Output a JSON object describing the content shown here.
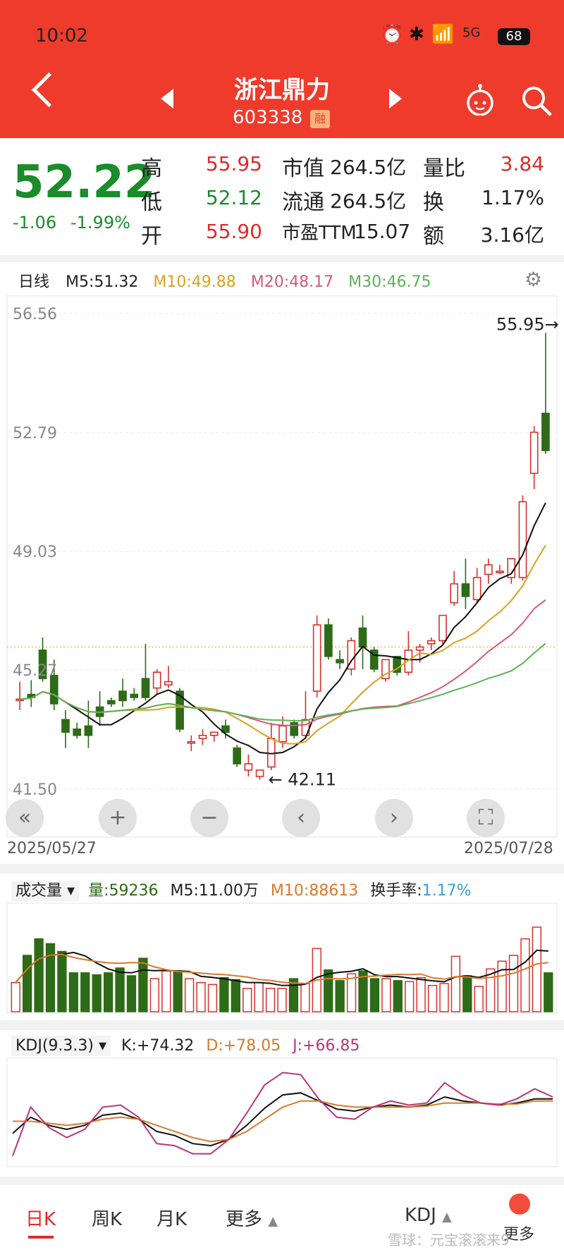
{
  "status": {
    "time": "10:02",
    "battery": "68",
    "signal": "5G"
  },
  "header": {
    "name": "浙江鼎力",
    "code": "603338",
    "badge": "融"
  },
  "quote": {
    "price": "52.22",
    "change": "-1.06",
    "change_pct": "-1.99%",
    "rows": [
      {
        "l1": "高",
        "v1": "55.95",
        "l2": "市值",
        "v2": "264.5亿",
        "l3": "量比",
        "v3": "3.84"
      },
      {
        "l1": "低",
        "v1": "52.12",
        "l2": "流通",
        "v2": "264.5亿",
        "l3": "换",
        "v3": "1.17%"
      },
      {
        "l1": "开",
        "v1": "55.90",
        "l2": "市盈TTM",
        "v2": "15.07",
        "l3": "额",
        "v3": "3.16亿"
      }
    ]
  },
  "kline": {
    "period": "日线",
    "ma": [
      {
        "label": "M5:51.32",
        "color": "#222222"
      },
      {
        "label": "M10:49.88",
        "color": "#d9a21b"
      },
      {
        "label": "M20:48.17",
        "color": "#d9577a"
      },
      {
        "label": "M30:46.75",
        "color": "#5db356"
      }
    ],
    "y_ticks": [
      "56.56",
      "52.79",
      "49.03",
      "45.27",
      "41.50"
    ],
    "high_label": "55.95",
    "low_label": "42.11",
    "date_start": "2025/05/27",
    "date_end": "2025/07/28"
  },
  "chart_data": [
    {
      "type": "candlestick",
      "x": [
        "2025/05/27",
        "2025/07/28"
      ],
      "ylim": [
        41.5,
        56.56
      ],
      "y_ticks": [
        56.56,
        52.79,
        49.03,
        45.27,
        41.5
      ],
      "candles": [
        [
          44.35,
          44.9,
          44.35,
          44.0
        ],
        [
          44.5,
          44.95,
          44.4,
          44.1
        ],
        [
          45.9,
          46.3,
          45.0,
          44.9
        ],
        [
          45.1,
          45.6,
          44.2,
          44.0
        ],
        [
          43.7,
          44.0,
          43.3,
          42.8
        ],
        [
          43.4,
          43.6,
          43.2,
          43.1
        ],
        [
          43.5,
          44.3,
          43.2,
          42.8
        ],
        [
          44.1,
          44.6,
          43.8,
          43.5
        ],
        [
          44.3,
          44.4,
          44.2,
          44.1
        ],
        [
          44.6,
          45.0,
          44.3,
          44.1
        ],
        [
          44.5,
          44.7,
          44.4,
          44.3
        ],
        [
          45.0,
          46.1,
          44.4,
          44.3
        ],
        [
          44.7,
          45.3,
          45.2,
          44.5
        ],
        [
          44.8,
          45.4,
          44.9,
          44.7
        ],
        [
          44.6,
          44.7,
          43.4,
          43.3
        ],
        [
          43.0,
          43.2,
          43.0,
          42.7
        ],
        [
          43.1,
          43.4,
          43.2,
          42.9
        ],
        [
          43.2,
          43.3,
          43.3,
          43.0
        ],
        [
          43.5,
          43.7,
          43.3,
          43.1
        ],
        [
          42.8,
          42.9,
          42.3,
          42.2
        ],
        [
          42.1,
          42.6,
          42.3,
          41.9
        ],
        [
          41.9,
          42.0,
          42.1,
          41.8
        ],
        [
          42.2,
          43.6,
          43.1,
          42.1
        ],
        [
          43.0,
          43.8,
          43.5,
          42.8
        ],
        [
          43.6,
          43.7,
          43.2,
          43.1
        ],
        [
          43.2,
          44.6,
          43.7,
          43.1
        ],
        [
          44.6,
          47.0,
          46.7,
          44.4
        ],
        [
          46.7,
          46.9,
          45.7,
          45.6
        ],
        [
          45.6,
          45.9,
          45.5,
          45.3
        ],
        [
          45.3,
          46.3,
          46.2,
          45.1
        ],
        [
          46.6,
          47.0,
          46.0,
          45.3
        ],
        [
          45.9,
          46.0,
          45.3,
          45.2
        ],
        [
          45.0,
          45.6,
          45.6,
          44.9
        ],
        [
          45.7,
          45.7,
          45.2,
          45.1
        ],
        [
          45.2,
          46.5,
          45.9,
          45.1
        ],
        [
          45.9,
          46.1,
          46.0,
          45.5
        ],
        [
          46.1,
          46.3,
          46.2,
          45.9
        ],
        [
          46.2,
          47.0,
          47.0,
          46.1
        ],
        [
          47.4,
          48.4,
          48.0,
          47.3
        ],
        [
          48.0,
          48.8,
          47.6,
          47.2
        ],
        [
          47.5,
          48.5,
          48.2,
          47.4
        ],
        [
          48.3,
          48.8,
          48.6,
          48.0
        ],
        [
          48.4,
          48.6,
          48.4,
          48.3
        ],
        [
          48.2,
          48.6,
          48.8,
          48.0
        ],
        [
          48.2,
          50.8,
          50.6,
          48.1
        ],
        [
          51.5,
          53.0,
          52.8,
          51.0
        ],
        [
          53.4,
          55.95,
          52.22,
          52.12
        ]
      ],
      "ma5_end": 51.32,
      "ma10_end": 49.88,
      "ma20_end": 48.17,
      "ma30_end": 46.75
    },
    {
      "type": "bar",
      "title": "成交量",
      "values": [
        30,
        58,
        75,
        70,
        62,
        40,
        40,
        38,
        40,
        45,
        37,
        55,
        34,
        42,
        42,
        34,
        30,
        28,
        35,
        33,
        24,
        30,
        24,
        24,
        34,
        29,
        65,
        43,
        32,
        39,
        42,
        34,
        34,
        32,
        31,
        35,
        27,
        29,
        57,
        37,
        26,
        44,
        52,
        58,
        75,
        87,
        40
      ]
    },
    {
      "type": "line",
      "title": "KDJ(9.3.3)",
      "series": [
        {
          "name": "K",
          "values": [
            30,
            46,
            38,
            34,
            38,
            48,
            50,
            44,
            32,
            28,
            20,
            18,
            24,
            38,
            55,
            68,
            70,
            62,
            54,
            52,
            56,
            58,
            56,
            58,
            66,
            62,
            60,
            58,
            60,
            64,
            64
          ]
        },
        {
          "name": "D",
          "values": [
            42,
            42,
            40,
            38,
            40,
            44,
            46,
            44,
            38,
            32,
            26,
            22,
            24,
            32,
            44,
            56,
            62,
            62,
            58,
            56,
            56,
            56,
            56,
            57,
            60,
            60,
            60,
            59,
            59,
            62,
            62
          ]
        },
        {
          "name": "J",
          "values": [
            8,
            56,
            36,
            26,
            34,
            56,
            58,
            46,
            20,
            18,
            10,
            10,
            24,
            50,
            78,
            90,
            88,
            64,
            46,
            44,
            56,
            62,
            58,
            60,
            80,
            68,
            60,
            58,
            64,
            74,
            66
          ]
        }
      ]
    }
  ],
  "volume": {
    "label": "成交量",
    "vol": "量:59236",
    "m5": "M5:11.00万",
    "m10": "M10:88613",
    "turn_label": "换手率:",
    "turn": "1.17%"
  },
  "kdj": {
    "label": "KDJ(9.3.3)",
    "k": "K:+74.32",
    "d": "D:+78.05",
    "j": "J:+66.85"
  },
  "tabs": {
    "day": "日K",
    "week": "周K",
    "month": "月K",
    "more": "更多",
    "indicator": "KDJ",
    "more2": "更多"
  },
  "watermark": "雪球：元宝滚滚来9",
  "colors": {
    "up": "#d8312c",
    "down": "#2e6b18",
    "header": "#ee3b2b"
  }
}
